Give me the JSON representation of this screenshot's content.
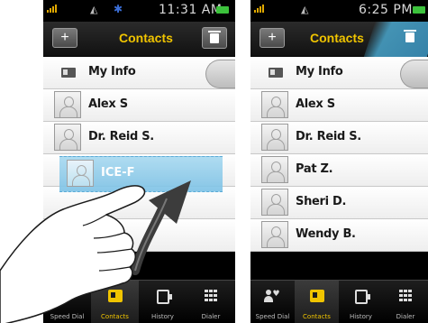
{
  "left_screen": {
    "status": {
      "time": "11:31 AM"
    },
    "title": "Contacts",
    "add_label": "+",
    "list": [
      {
        "label": "My Info",
        "kind": "myinfo"
      },
      {
        "label": "Alex S",
        "kind": "contact"
      },
      {
        "label": "Dr. Reid S.",
        "kind": "contact"
      },
      {
        "label": "",
        "kind": "empty"
      },
      {
        "label": "",
        "kind": "empty"
      },
      {
        "label": "",
        "kind": "empty"
      }
    ],
    "dragged_item": {
      "label": "ICE-F"
    }
  },
  "right_screen": {
    "status": {
      "time": "6:25 PM"
    },
    "title": "Contacts",
    "add_label": "+",
    "trash_overlay_text": "",
    "list": [
      {
        "label": "My Info",
        "kind": "myinfo"
      },
      {
        "label": "Alex S",
        "kind": "contact"
      },
      {
        "label": "Dr. Reid S.",
        "kind": "contact"
      },
      {
        "label": "Pat Z.",
        "kind": "contact"
      },
      {
        "label": "Sheri D.",
        "kind": "contact"
      },
      {
        "label": "Wendy B.",
        "kind": "contact"
      }
    ]
  },
  "nav": {
    "items": [
      {
        "label": "Speed Dial",
        "icon": "speed-dial-icon"
      },
      {
        "label": "Contacts",
        "icon": "contacts-icon",
        "active": true
      },
      {
        "label": "History",
        "icon": "history-icon"
      },
      {
        "label": "Dialer",
        "icon": "dialer-icon"
      }
    ]
  },
  "colors": {
    "accent": "#f0c400",
    "drag_highlight": "#7cc2e6",
    "battery": "#3cc23c"
  }
}
